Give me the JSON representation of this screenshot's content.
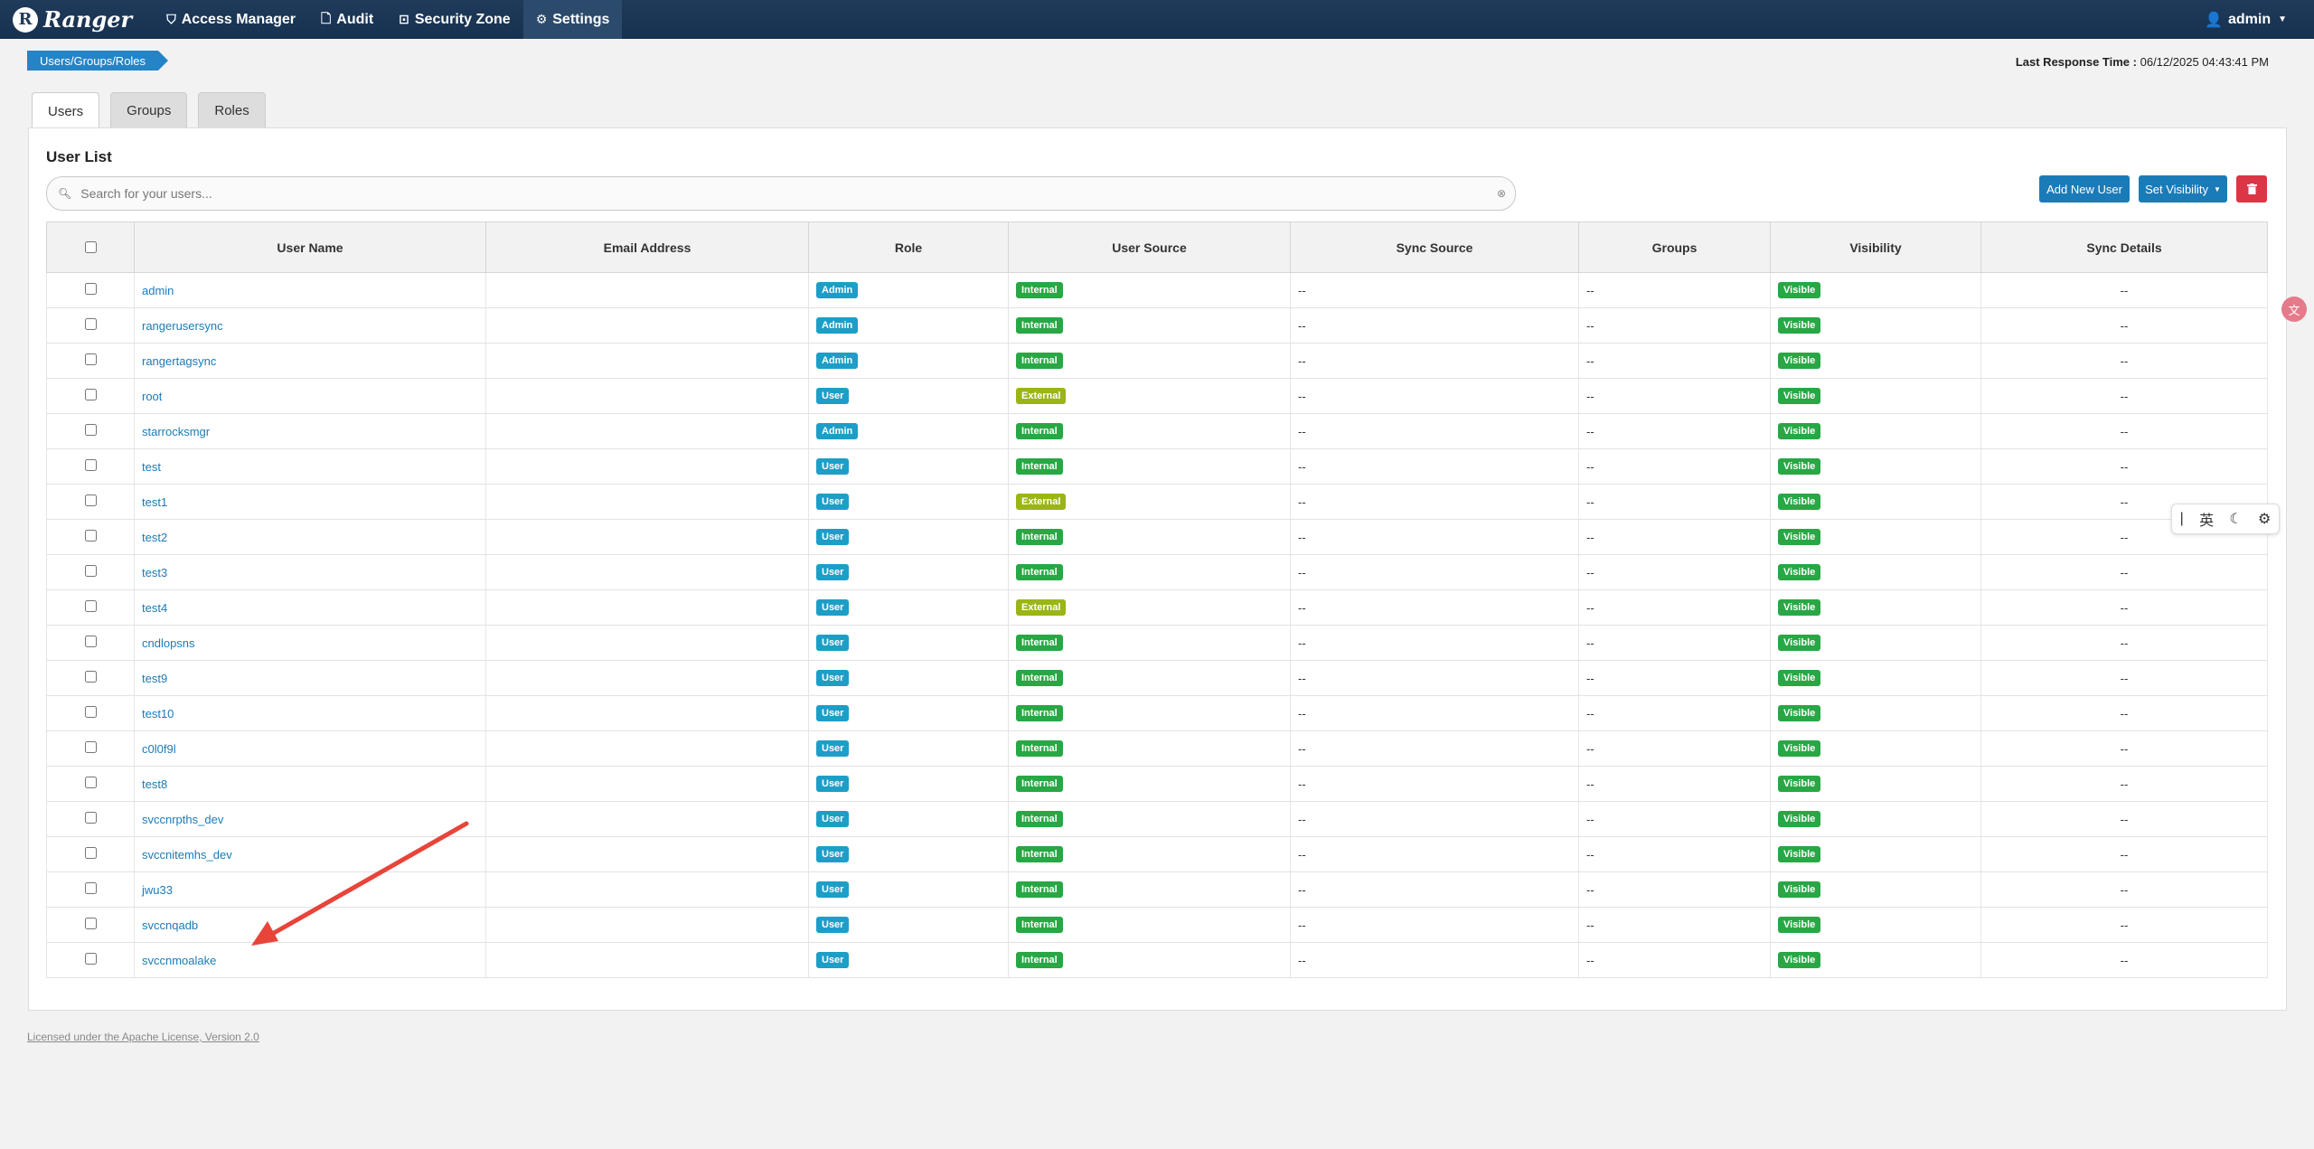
{
  "navbar": {
    "brand": "Ranger",
    "brand_logo": "R",
    "items": [
      {
        "label": "Access Manager",
        "icon": "shield-icon"
      },
      {
        "label": "Audit",
        "icon": "file-icon"
      },
      {
        "label": "Security Zone",
        "icon": "zone-icon"
      },
      {
        "label": "Settings",
        "icon": "gear-icon",
        "active": true
      }
    ],
    "user": "admin"
  },
  "breadcrumb": "Users/Groups/Roles",
  "last_response": {
    "label": "Last Response Time :",
    "value": "06/12/2025 04:43:41 PM"
  },
  "tabs": [
    {
      "label": "Users",
      "active": true
    },
    {
      "label": "Groups"
    },
    {
      "label": "Roles"
    }
  ],
  "panel": {
    "title": "User List",
    "search_placeholder": "Search for your users...",
    "add_button": "Add New User",
    "visibility_button": "Set Visibility",
    "delete_icon": "trash-icon"
  },
  "table": {
    "columns": [
      "User Name",
      "Email Address",
      "Role",
      "User Source",
      "Sync Source",
      "Groups",
      "Visibility",
      "Sync Details"
    ],
    "rows": [
      {
        "name": "admin",
        "email": "",
        "role": "Admin",
        "source": "Internal",
        "sync": "--",
        "groups": "--",
        "visibility": "Visible",
        "details": "--"
      },
      {
        "name": "rangerusersync",
        "email": "",
        "role": "Admin",
        "source": "Internal",
        "sync": "--",
        "groups": "--",
        "visibility": "Visible",
        "details": "--"
      },
      {
        "name": "rangertagsync",
        "email": "",
        "role": "Admin",
        "source": "Internal",
        "sync": "--",
        "groups": "--",
        "visibility": "Visible",
        "details": "--"
      },
      {
        "name": "root",
        "email": "",
        "role": "User",
        "source": "External",
        "sync": "--",
        "groups": "--",
        "visibility": "Visible",
        "details": "--"
      },
      {
        "name": "starrocksmgr",
        "email": "",
        "role": "Admin",
        "source": "Internal",
        "sync": "--",
        "groups": "--",
        "visibility": "Visible",
        "details": "--"
      },
      {
        "name": "test",
        "email": "",
        "role": "User",
        "source": "Internal",
        "sync": "--",
        "groups": "--",
        "visibility": "Visible",
        "details": "--"
      },
      {
        "name": "test1",
        "email": "",
        "role": "User",
        "source": "External",
        "sync": "--",
        "groups": "--",
        "visibility": "Visible",
        "details": "--"
      },
      {
        "name": "test2",
        "email": "",
        "role": "User",
        "source": "Internal",
        "sync": "--",
        "groups": "--",
        "visibility": "Visible",
        "details": "--"
      },
      {
        "name": "test3",
        "email": "",
        "role": "User",
        "source": "Internal",
        "sync": "--",
        "groups": "--",
        "visibility": "Visible",
        "details": "--"
      },
      {
        "name": "test4",
        "email": "",
        "role": "User",
        "source": "External",
        "sync": "--",
        "groups": "--",
        "visibility": "Visible",
        "details": "--"
      },
      {
        "name": "cndlopsns",
        "email": "",
        "role": "User",
        "source": "Internal",
        "sync": "--",
        "groups": "--",
        "visibility": "Visible",
        "details": "--"
      },
      {
        "name": "test9",
        "email": "",
        "role": "User",
        "source": "Internal",
        "sync": "--",
        "groups": "--",
        "visibility": "Visible",
        "details": "--"
      },
      {
        "name": "test10",
        "email": "",
        "role": "User",
        "source": "Internal",
        "sync": "--",
        "groups": "--",
        "visibility": "Visible",
        "details": "--"
      },
      {
        "name": "c0l0f9l",
        "email": "",
        "role": "User",
        "source": "Internal",
        "sync": "--",
        "groups": "--",
        "visibility": "Visible",
        "details": "--"
      },
      {
        "name": "test8",
        "email": "",
        "role": "User",
        "source": "Internal",
        "sync": "--",
        "groups": "--",
        "visibility": "Visible",
        "details": "--"
      },
      {
        "name": "svccnrpths_dev",
        "email": "",
        "role": "User",
        "source": "Internal",
        "sync": "--",
        "groups": "--",
        "visibility": "Visible",
        "details": "--"
      },
      {
        "name": "svccnitemhs_dev",
        "email": "",
        "role": "User",
        "source": "Internal",
        "sync": "--",
        "groups": "--",
        "visibility": "Visible",
        "details": "--"
      },
      {
        "name": "jwu33",
        "email": "",
        "role": "User",
        "source": "Internal",
        "sync": "--",
        "groups": "--",
        "visibility": "Visible",
        "details": "--"
      },
      {
        "name": "svccnqadb",
        "email": "",
        "role": "User",
        "source": "Internal",
        "sync": "--",
        "groups": "--",
        "visibility": "Visible",
        "details": "--"
      },
      {
        "name": "svccnmoalake",
        "email": "",
        "role": "User",
        "source": "Internal",
        "sync": "--",
        "groups": "--",
        "visibility": "Visible",
        "details": "--"
      }
    ]
  },
  "footer": {
    "license": "Licensed under the Apache License, Version 2.0"
  },
  "ime_toolbar": {
    "cursor": "|",
    "lang": "英",
    "moon": "☾",
    "gear": "⚙"
  },
  "translate_icon": "文",
  "colors": {
    "navbar": "#1f3a5a",
    "primary": "#1a7bb9",
    "danger": "#dc3545",
    "internal": "#28a745",
    "external": "#9ab516",
    "role": "#1d9ec7",
    "annotation_arrow": "#e8443a"
  }
}
